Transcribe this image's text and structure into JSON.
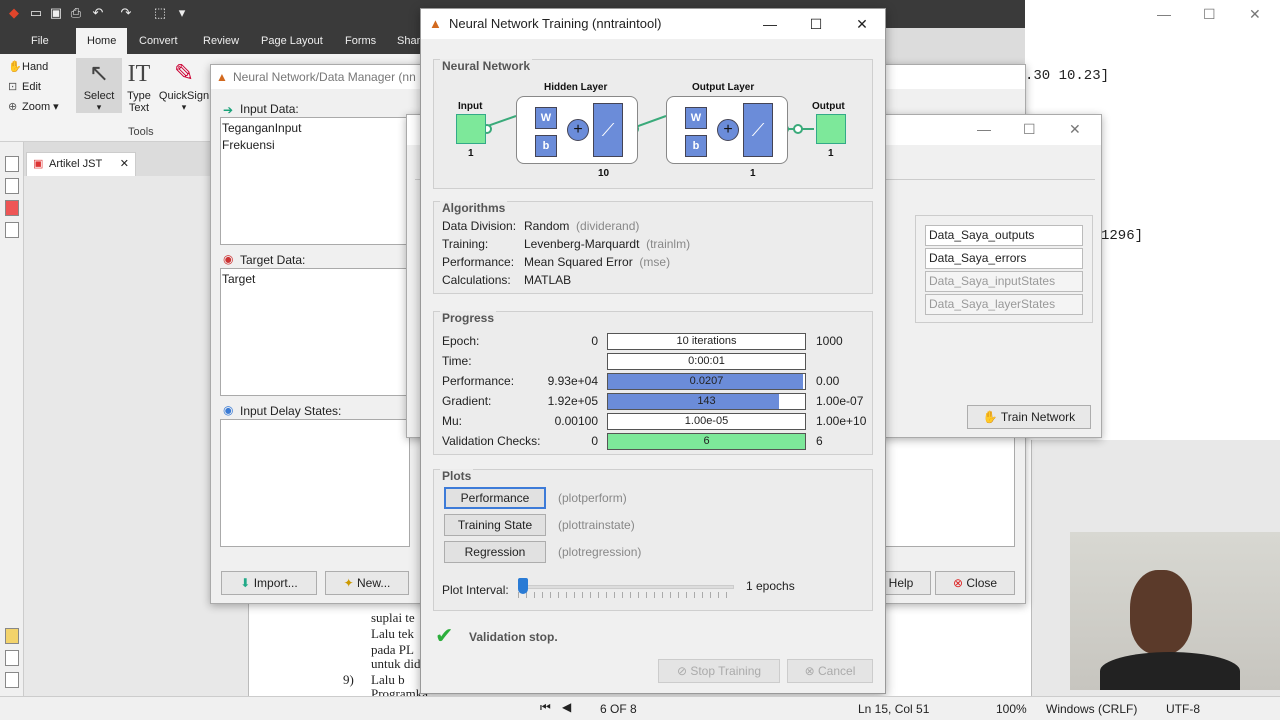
{
  "editor": {
    "ribbon_tabs": [
      "File",
      "Home",
      "Convert",
      "Review",
      "Page Layout",
      "Forms",
      "Shar"
    ],
    "tools": {
      "hand": "Hand",
      "edit": "Edit",
      "zoom": "Zoom",
      "select": "Select",
      "type_text_1": "Type",
      "type_text_2": "Text",
      "quicksign": "QuickSign",
      "group_label": "Tools"
    },
    "doc_tab": "Artikel JST",
    "page_text": {
      "l1": "suplai te",
      "l2": "Lalu tek",
      "l3": "pada PL",
      "l4": "untuk did",
      "l5_num": "9)",
      "l5": "Lalu b",
      "l6": "Programka"
    },
    "right_doc_lines": [
      ".30 10.23]",
      "1296]"
    ],
    "status": {
      "page": "6 OF 8",
      "position": "Ln 15, Col 51",
      "zoom": "100%",
      "line_endings": "Windows (CRLF)",
      "encoding": "UTF-8"
    }
  },
  "data_manager": {
    "title": "Neural Network/Data Manager (nn",
    "input_label": "Input Data:",
    "input_items": [
      "TeganganInput",
      "Frekuensi"
    ],
    "target_label": "Target Data:",
    "target_items": [
      "Target"
    ],
    "delay_label": "Input Delay States:",
    "import_btn": "Import...",
    "new_btn": "New...",
    "help_btn": "Help",
    "close_btn": "Close"
  },
  "network_window": {
    "outputs": [
      "Data_Saya_outputs",
      "Data_Saya_errors",
      "Data_Saya_inputStates",
      "Data_Saya_layerStates"
    ],
    "train_btn": "Train Network"
  },
  "nntraintool": {
    "title": "Neural Network Training (nntraintool)",
    "network": {
      "section": "Neural Network",
      "input_label": "Input",
      "input_size": "1",
      "hidden_label": "Hidden Layer",
      "hidden_size": "10",
      "output_layer_label": "Output Layer",
      "output_layer_size": "1",
      "output_label": "Output",
      "output_size": "1",
      "w": "W",
      "b": "b"
    },
    "algorithms": {
      "section": "Algorithms",
      "rows": [
        {
          "k": "Data Division:",
          "v": "Random",
          "f": "(dividerand)"
        },
        {
          "k": "Training:",
          "v": "Levenberg-Marquardt",
          "f": "(trainlm)"
        },
        {
          "k": "Performance:",
          "v": "Mean Squared Error",
          "f": "(mse)"
        },
        {
          "k": "Calculations:",
          "v": "MATLAB",
          "f": ""
        }
      ]
    },
    "progress": {
      "section": "Progress",
      "rows": [
        {
          "k": "Epoch:",
          "min": "0",
          "bar": "10 iterations",
          "max": "1000",
          "fill": 0.0,
          "color": "#6b8cd9"
        },
        {
          "k": "Time:",
          "min": "",
          "bar": "0:00:01",
          "max": "",
          "fill": 0.0,
          "color": "#6b8cd9"
        },
        {
          "k": "Performance:",
          "min": "9.93e+04",
          "bar": "0.0207",
          "max": "0.00",
          "fill": 0.99,
          "color": "#6b8cd9"
        },
        {
          "k": "Gradient:",
          "min": "1.92e+05",
          "bar": "143",
          "max": "1.00e-07",
          "fill": 0.87,
          "color": "#6b8cd9"
        },
        {
          "k": "Mu:",
          "min": "0.00100",
          "bar": "1.00e-05",
          "max": "1.00e+10",
          "fill": 0.0,
          "color": "#6b8cd9"
        },
        {
          "k": "Validation Checks:",
          "min": "0",
          "bar": "6",
          "max": "6",
          "fill": 1.0,
          "color": "#7de89a"
        }
      ]
    },
    "plots": {
      "section": "Plots",
      "buttons": [
        {
          "label": "Performance",
          "fn": "(plotperform)"
        },
        {
          "label": "Training State",
          "fn": "(plottrainstate)"
        },
        {
          "label": "Regression",
          "fn": "(plotregression)"
        }
      ],
      "interval_label": "Plot Interval:",
      "interval_value": "1 epochs"
    },
    "status_text": "Validation stop.",
    "stop_btn": "Stop Training",
    "cancel_btn": "Cancel"
  }
}
